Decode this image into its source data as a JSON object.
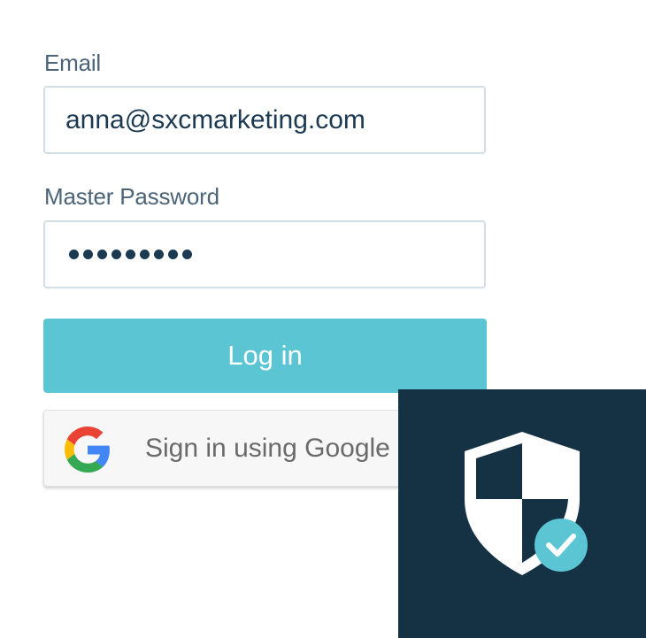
{
  "form": {
    "email_label": "Email",
    "email_value": "anna@sxcmarketing.com",
    "password_label": "Master Password",
    "password_dot_count": 9,
    "login_label": "Log in",
    "google_label": "Sign in using Google"
  },
  "icons": {
    "google": "google-g-icon",
    "shield": "shield-check-icon"
  },
  "colors": {
    "login_button": "#5bc5d4",
    "panel_background": "#143244",
    "check_badge": "#5bc5d4",
    "field_text": "#1b3a52",
    "label_text": "#4b6477"
  }
}
